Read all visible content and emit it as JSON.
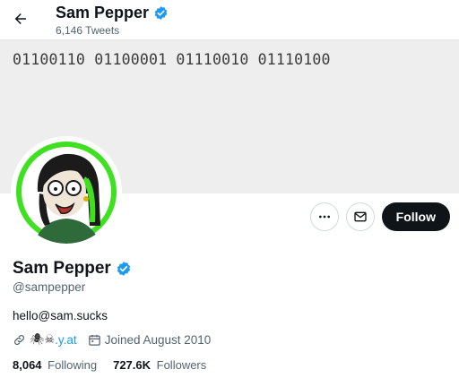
{
  "header": {
    "name": "Sam Pepper",
    "tweet_count": "6,146 Tweets"
  },
  "banner": {
    "text": "01100110 01100001 01110010 01110100",
    "background": "#eeeeee"
  },
  "actions": {
    "more_icon": "more-icon",
    "message_icon": "envelope-icon",
    "follow_label": "Follow"
  },
  "profile": {
    "name": "Sam Pepper",
    "verified_icon": "verified-badge-icon",
    "handle": "@sampepper",
    "bio": "hello@sam.sucks",
    "website_prefix": "🕷☠",
    "website_text": ".y.at",
    "joined": "Joined August 2010"
  },
  "stats": {
    "following_count": "8,064",
    "following_label": "Following",
    "followers_count": "727.6K",
    "followers_label": "Followers"
  },
  "colors": {
    "accent": "#1d9bf0",
    "follow_button": "#0f1419",
    "avatar_ring": "#3ee020"
  }
}
